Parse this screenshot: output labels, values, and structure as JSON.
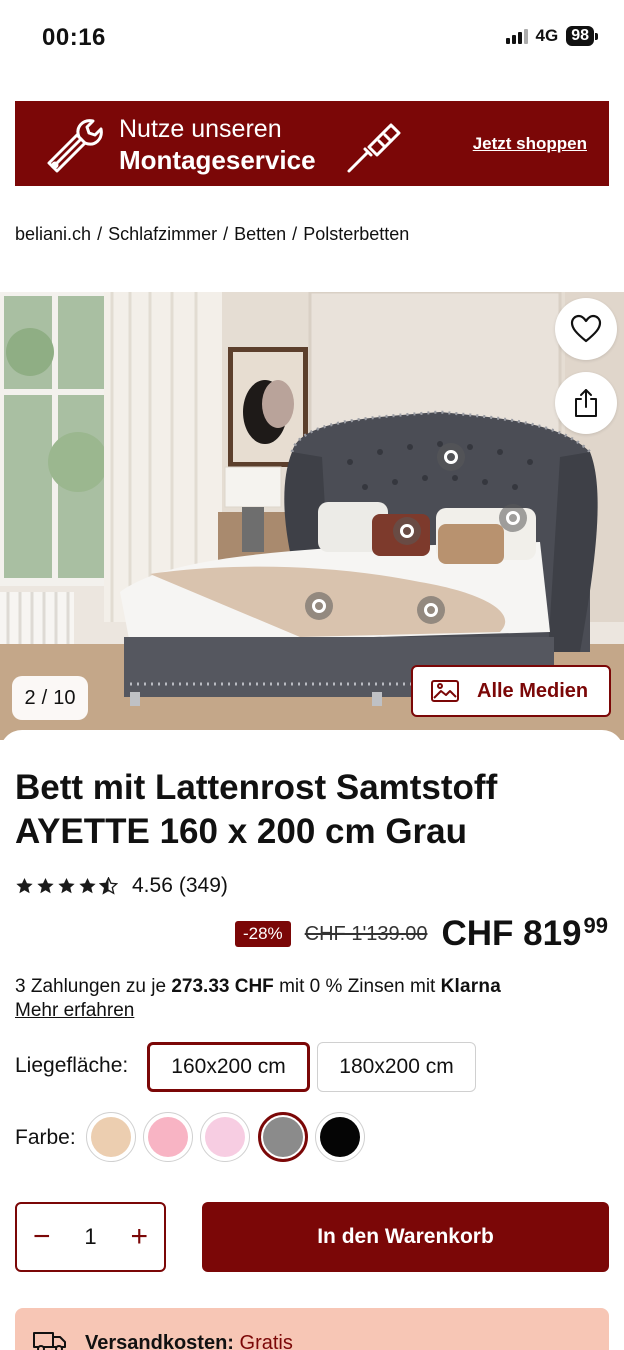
{
  "status_bar": {
    "time": "00:16",
    "network": "4G",
    "battery": "98"
  },
  "promo": {
    "line1": "Nutze unseren",
    "line2": "Montageservice",
    "cta": "Jetzt shoppen",
    "icons": [
      "wrench-icon",
      "screwdriver-icon"
    ]
  },
  "breadcrumb": {
    "items": [
      "beliani.ch",
      "Schlafzimmer",
      "Betten",
      "Polsterbetten"
    ],
    "separator": "/"
  },
  "gallery": {
    "counter_current": "2",
    "counter_sep": "/",
    "counter_total": "10",
    "all_media_label": "Alle Medien",
    "actions": [
      "heart-icon",
      "share-icon"
    ]
  },
  "product": {
    "title": "Bett mit Lattenrost Samtstoff AYETTE 160 x 200 cm Grau",
    "rating_value": "4.56",
    "rating_count": "(349)",
    "stars": 4.56,
    "discount": "-28%",
    "old_price": "CHF 1'139.00",
    "price_main": "CHF 819",
    "price_cents": "99"
  },
  "klarna": {
    "prefix": "3 Zahlungen zu je",
    "amount": "273.33 CHF",
    "suffix": "mit 0 % Zinsen mit",
    "brand": "Klarna",
    "more": "Mehr erfahren"
  },
  "options": {
    "size_label": "Liegefläche:",
    "sizes": [
      "160x200 cm",
      "180x200 cm"
    ],
    "selected_size": "160x200 cm",
    "color_label": "Farbe:",
    "colors": [
      "#ecceb0",
      "#f8b4c4",
      "#f7cde2",
      "#8b8b8b",
      "#050505"
    ],
    "selected_color": "#8b8b8b"
  },
  "cart": {
    "quantity": "1",
    "minus": "−",
    "plus": "+",
    "add_label": "In den Warenkorb"
  },
  "shipping": {
    "label": "Versandkosten:",
    "value": "Gratis"
  },
  "theme": {
    "accent": "#7b0707",
    "shipping_bg": "#f7c6b5"
  }
}
